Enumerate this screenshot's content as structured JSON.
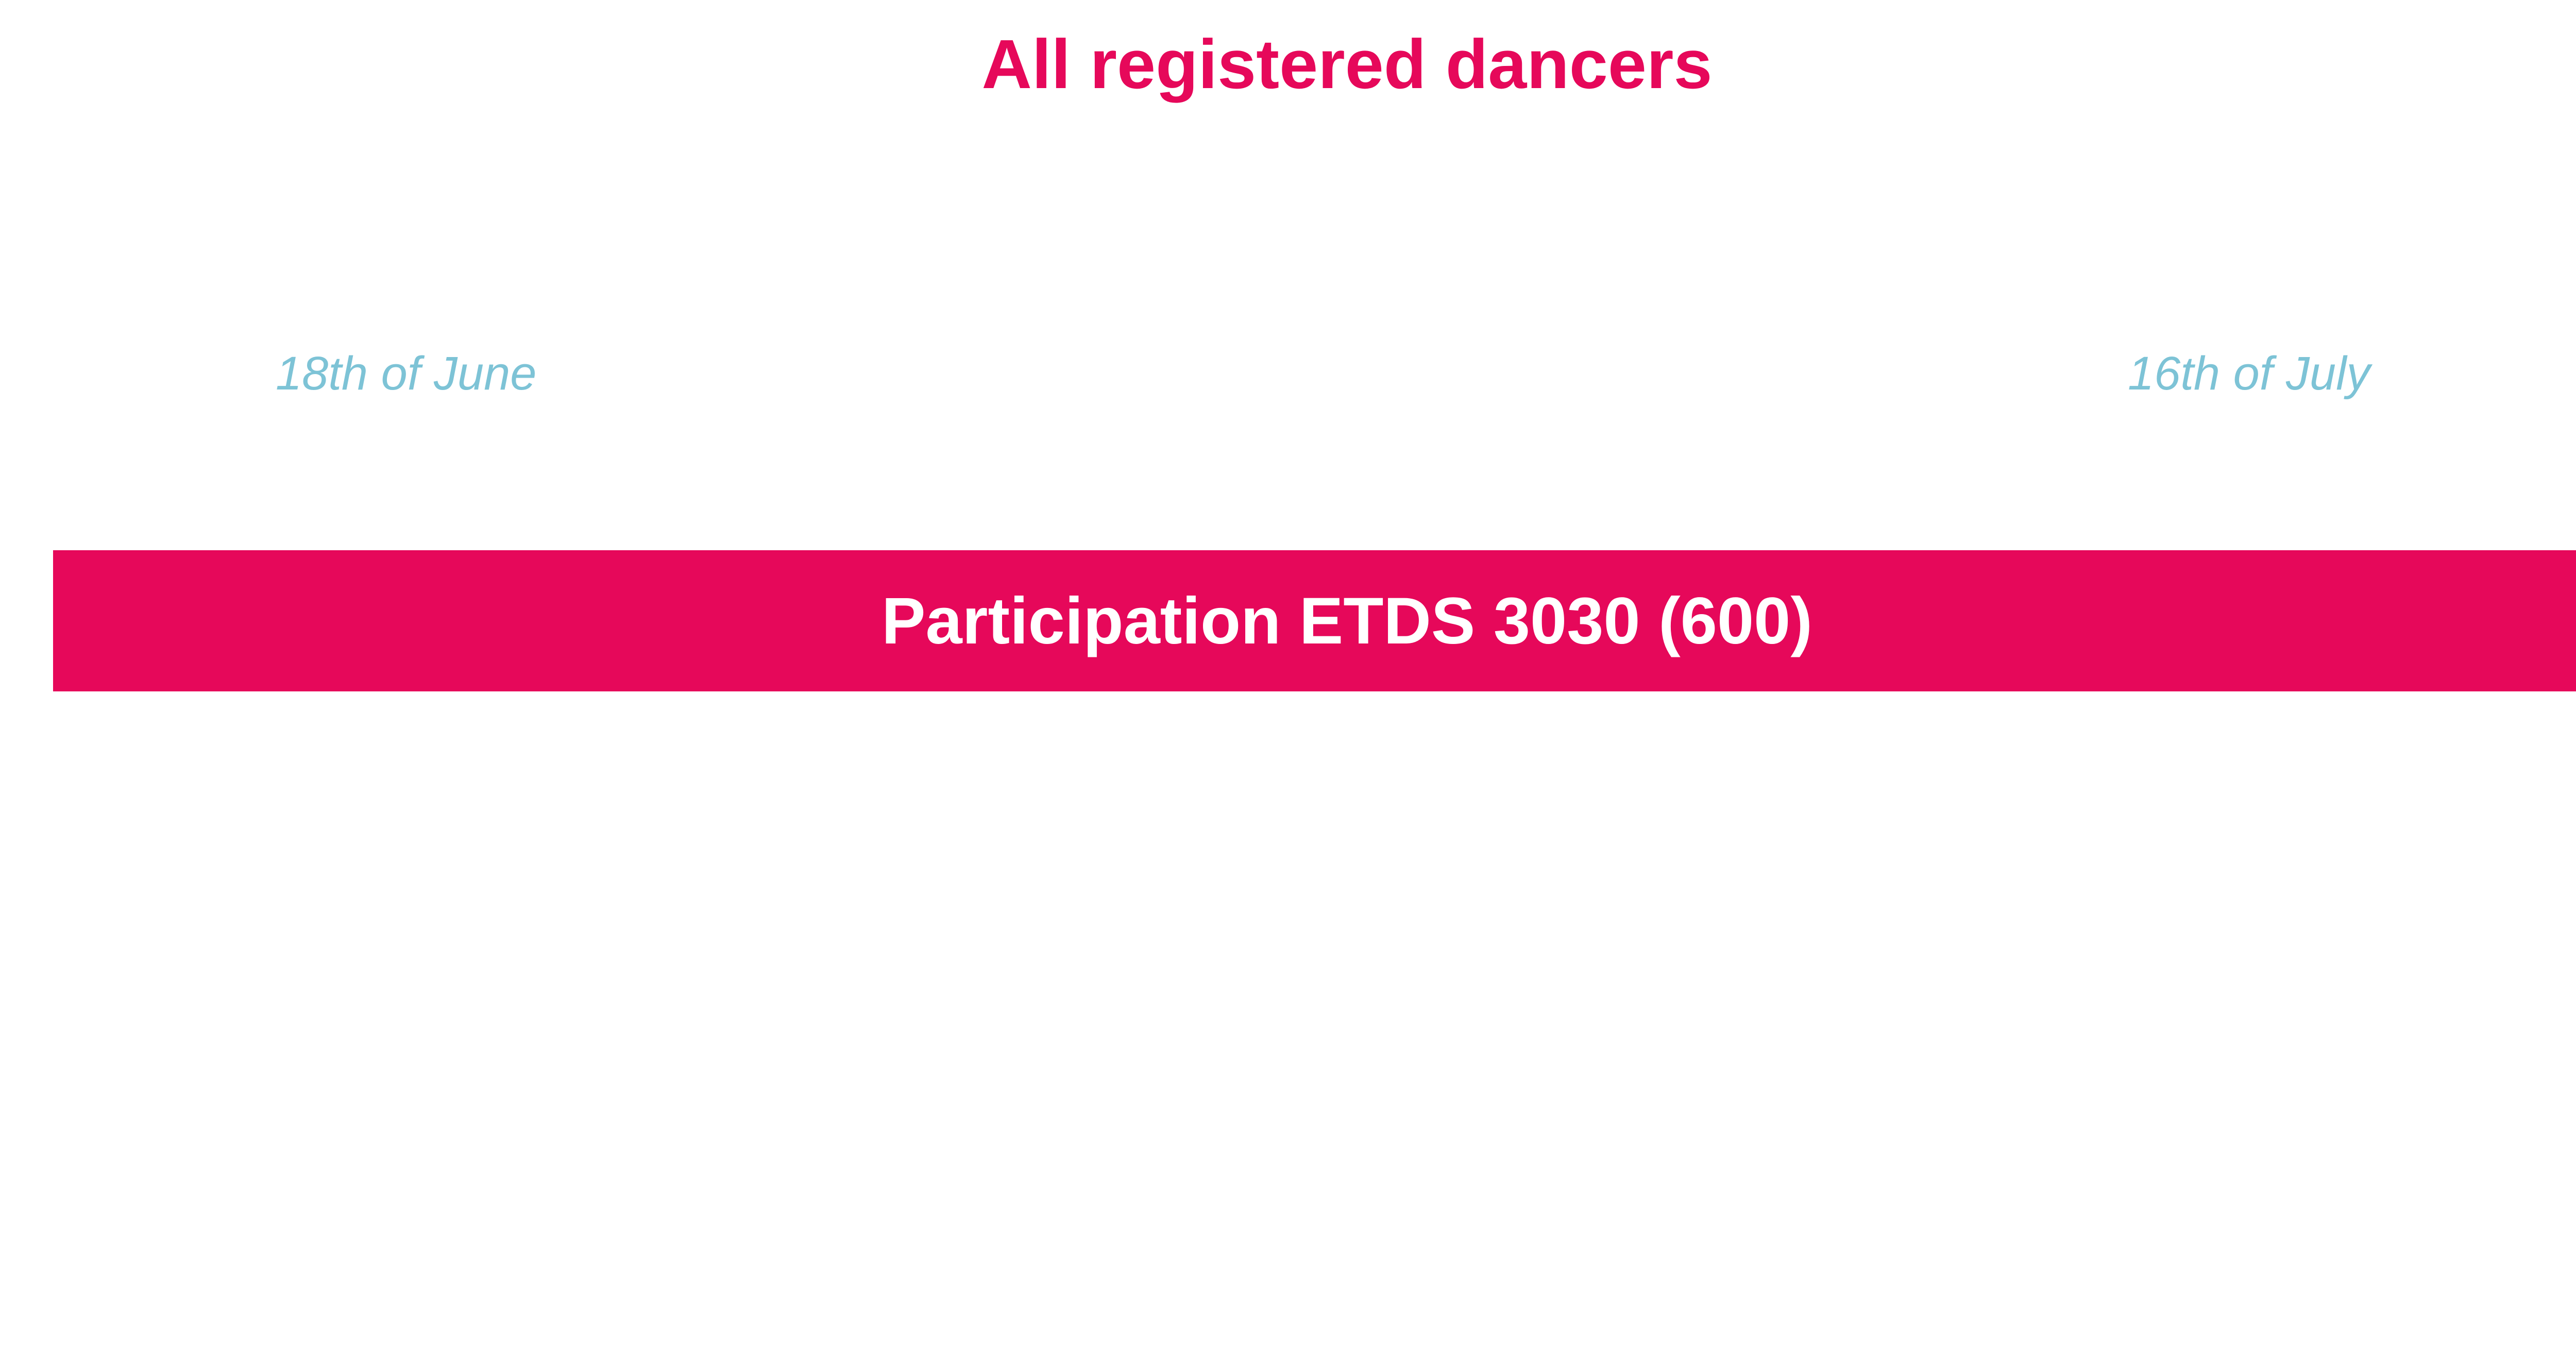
{
  "title": "All registered dancers",
  "dates": {
    "start": "18th of June",
    "end": "16th of July"
  },
  "bar": {
    "label": "Participation ETDS 3030 (600)"
  },
  "colors": {
    "accent": "#e6085a",
    "date_text": "#7dc3d6",
    "bar_text": "#ffffff",
    "background": "#ffffff"
  }
}
